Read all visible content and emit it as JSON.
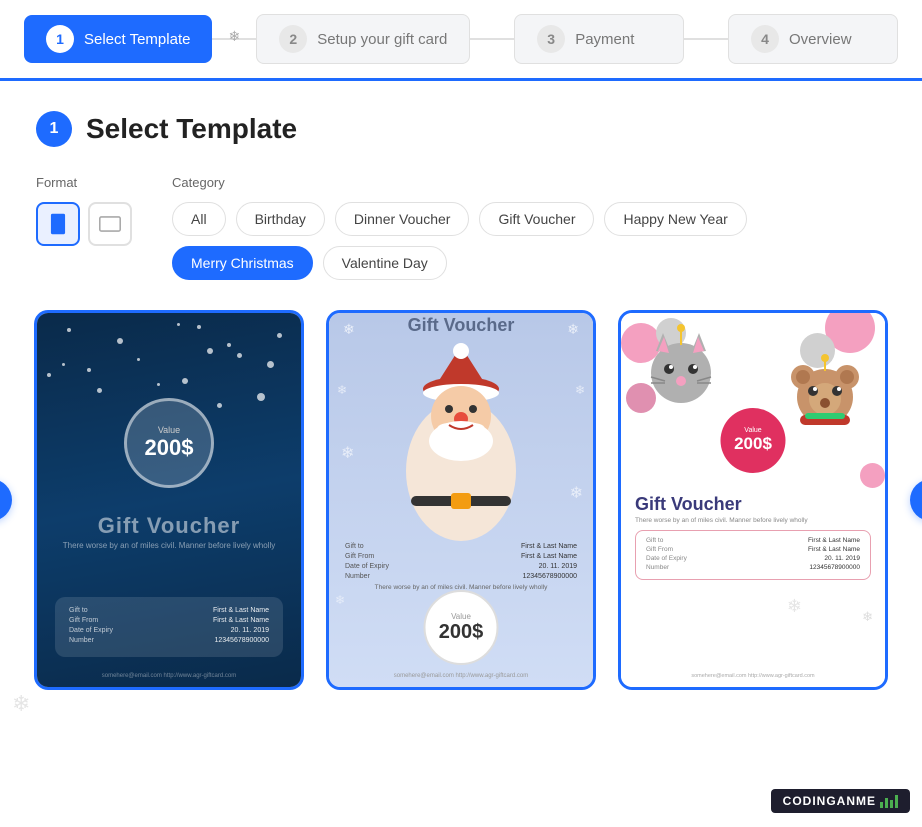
{
  "stepper": {
    "steps": [
      {
        "number": "1",
        "label": "Select Template",
        "state": "active"
      },
      {
        "number": "2",
        "label": "Setup your gift card",
        "state": "inactive"
      },
      {
        "number": "3",
        "label": "Payment",
        "state": "inactive"
      },
      {
        "number": "4",
        "label": "Overview",
        "state": "inactive"
      }
    ]
  },
  "page": {
    "badge": "1",
    "title": "Select Template"
  },
  "format": {
    "label": "Format",
    "portrait_active": true,
    "landscape_active": false
  },
  "category": {
    "label": "Category",
    "chips": [
      {
        "label": "All",
        "active": false
      },
      {
        "label": "Birthday",
        "active": false
      },
      {
        "label": "Dinner Voucher",
        "active": false
      },
      {
        "label": "Gift Voucher",
        "active": false
      },
      {
        "label": "Happy New Year",
        "active": false
      },
      {
        "label": "Merry Christmas",
        "active": true
      },
      {
        "label": "Valentine Day",
        "active": false
      }
    ]
  },
  "cards": [
    {
      "id": "card1",
      "theme": "dark-christmas",
      "value_label": "Value",
      "value": "200$",
      "title": "Gift Voucher",
      "subtitle": "There worse by an of miles civil. Manner before lively wholly",
      "details": [
        {
          "key": "Gift to",
          "val": "First & Last Name"
        },
        {
          "key": "Gift From",
          "val": "First & Last Name"
        },
        {
          "key": "Date of Expiry",
          "val": "20. 11. 2019"
        },
        {
          "key": "Number",
          "val": "12345678900000"
        }
      ],
      "footer": "somehere@email.com   http://www.agr-giftcard.com"
    },
    {
      "id": "card2",
      "theme": "santa",
      "title": "Gift Voucher",
      "details": [
        {
          "key": "Gift to",
          "val": "First & Last Name"
        },
        {
          "key": "Gift From",
          "val": "First & Last Name"
        },
        {
          "key": "Date of Expiry",
          "val": "20. 11. 2019"
        },
        {
          "key": "Number",
          "val": "12345678900000"
        }
      ],
      "desc": "There worse by an of miles civil. Manner before lively wholly",
      "value_label": "Value",
      "value": "200$",
      "footer": "somehere@email.com   http://www.agr-giftcard.com"
    },
    {
      "id": "card3",
      "theme": "animals-christmas",
      "badge_label": "Value",
      "badge_value": "200$",
      "title": "Gift Voucher",
      "subtitle": "There worse by an of miles civil. Manner before lively wholly",
      "details": [
        {
          "key": "Gift to",
          "val": "First & Last Name"
        },
        {
          "key": "Gift From",
          "val": "First & Last Name"
        },
        {
          "key": "Date of Expiry",
          "val": "20. 11. 2019"
        },
        {
          "key": "Number",
          "val": "12345678900000"
        }
      ],
      "footer": "somehere@email.com   http://www.agr-giftcard.com"
    }
  ],
  "nav": {
    "prev": "‹",
    "next": "›"
  },
  "brand": {
    "name": "CODINGANME",
    "bars": [
      6,
      10,
      8,
      12,
      9,
      14
    ]
  }
}
